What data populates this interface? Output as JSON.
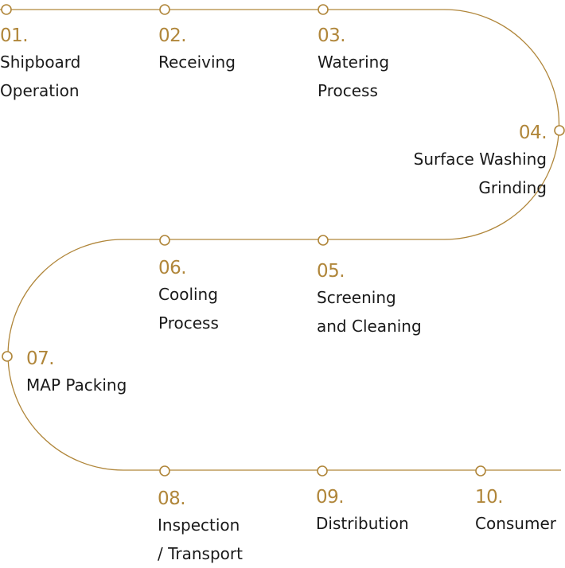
{
  "colors": {
    "accent": "#b0863a",
    "text": "#1a1a1a"
  },
  "steps": [
    {
      "num": "01.",
      "lines": [
        "Shipboard",
        "Operation"
      ]
    },
    {
      "num": "02.",
      "lines": [
        "Receiving"
      ]
    },
    {
      "num": "03.",
      "lines": [
        "Watering",
        "Process"
      ]
    },
    {
      "num": "04.",
      "lines": [
        "Surface Washing",
        "Grinding"
      ]
    },
    {
      "num": "05.",
      "lines": [
        "Screening",
        "and Cleaning"
      ]
    },
    {
      "num": "06.",
      "lines": [
        "Cooling",
        "Process"
      ]
    },
    {
      "num": "07.",
      "lines": [
        "MAP Packing"
      ]
    },
    {
      "num": "08.",
      "lines": [
        "Inspection",
        "/ Transport"
      ]
    },
    {
      "num": "09.",
      "lines": [
        "Distribution"
      ]
    },
    {
      "num": "10.",
      "lines": [
        "Consumer"
      ]
    }
  ]
}
